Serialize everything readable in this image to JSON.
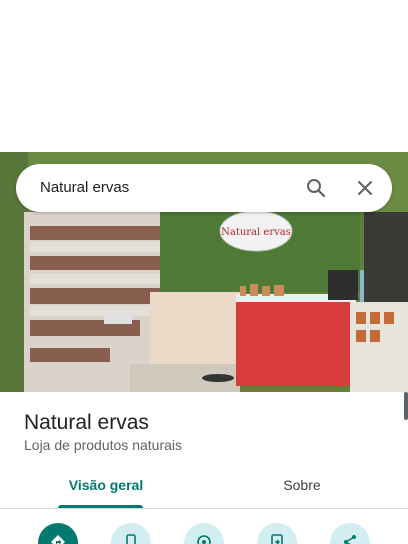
{
  "search": {
    "query": "Natural ervas"
  },
  "photo": {
    "sign_text": "Natural ervas"
  },
  "place": {
    "name": "Natural ervas",
    "category": "Loja de produtos naturais"
  },
  "tabs": [
    {
      "label": "Visão geral",
      "selected": true
    },
    {
      "label": "Sobre",
      "selected": false
    }
  ],
  "actions": [
    {
      "icon": "directions-icon"
    },
    {
      "icon": "phone-icon"
    },
    {
      "icon": "nearby-icon"
    },
    {
      "icon": "send-to-phone-icon"
    },
    {
      "icon": "share-icon"
    }
  ],
  "colors": {
    "accent": "#01796f",
    "action_bg": "#d2eef0"
  }
}
